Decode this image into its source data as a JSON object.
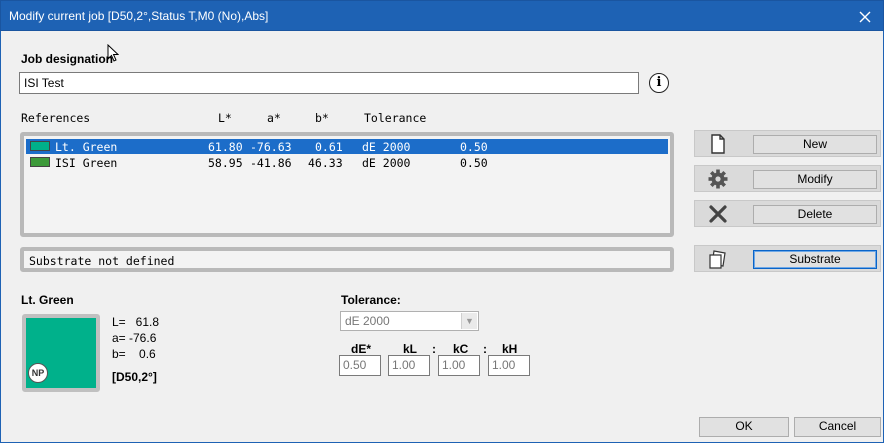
{
  "window": {
    "title": "Modify current job  [D50,2°,Status T,M0 (No),Abs]"
  },
  "job": {
    "label": "Job designation",
    "value": "ISI Test"
  },
  "list_headers": {
    "references": "References",
    "l": "L*",
    "a": "a*",
    "b": "b*",
    "tolerance": "Tolerance"
  },
  "references": [
    {
      "name": "Lt. Green",
      "l": "61.80",
      "a": "-76.63",
      "b": "0.61",
      "method": "dE 2000",
      "tol": "0.50",
      "swatch_color": "#00b08a",
      "selected": true
    },
    {
      "name": "ISI Green",
      "l": "58.95",
      "a": "-41.86",
      "b": "46.33",
      "method": "dE 2000",
      "tol": "0.50",
      "swatch_color": "#3d9a3a",
      "selected": false
    }
  ],
  "substrate_status": "Substrate not defined",
  "actions": {
    "new": "New",
    "modify": "Modify",
    "delete": "Delete",
    "substrate": "Substrate"
  },
  "detail": {
    "name": "Lt. Green",
    "l_line": "L=   61.8",
    "a_line": "a= -76.6",
    "b_line": "b=    0.6",
    "illuminant": "[D50,2°]",
    "swatch_color": "#00b18b",
    "badge": "NP"
  },
  "tolerance": {
    "label": "Tolerance:",
    "method": "dE 2000",
    "de_label": "dE*",
    "kl_label": "kL",
    "kc_label": "kC",
    "kh_label": "kH",
    "sep": ":",
    "de_value": "0.50",
    "kl_value": "1.00",
    "kc_value": "1.00",
    "kh_value": "1.00"
  },
  "footer": {
    "ok": "OK",
    "cancel": "Cancel"
  },
  "colors": {
    "titlebar": "#1e62b4",
    "selection": "#1c6dc9"
  }
}
